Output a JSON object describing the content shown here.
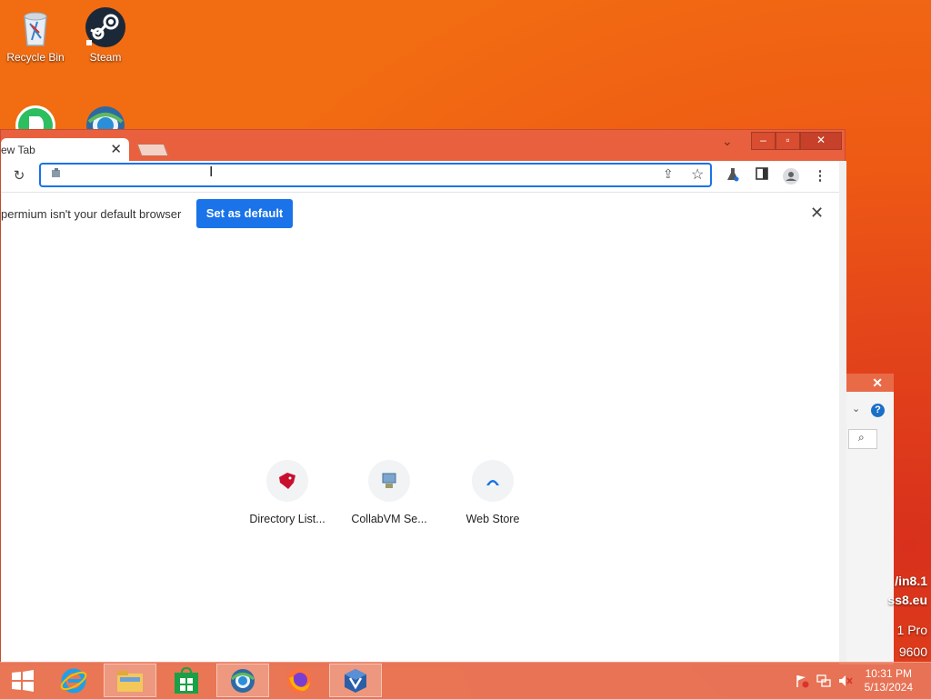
{
  "desktop": {
    "icons": [
      {
        "label": "Recycle Bin"
      },
      {
        "label": "Steam"
      }
    ],
    "right_edge_text": [
      "/in8.1",
      "ss8.eu",
      "1 Pro",
      "9600"
    ]
  },
  "browser": {
    "tab": {
      "title": "ew Tab",
      "close": "✕"
    },
    "omnibox": {
      "value": "",
      "placeholder": ""
    },
    "infobar": {
      "message": "permium isn't your default browser",
      "button": "Set as default",
      "close": "✕"
    },
    "shortcuts": [
      {
        "label": "Directory List..."
      },
      {
        "label": "CollabVM Se..."
      },
      {
        "label": "Web Store"
      }
    ]
  },
  "taskbar": {
    "time": "10:31 PM",
    "date": "5/13/2024"
  },
  "colors": {
    "accent": "#1a73e8",
    "window_frame": "#e9603e"
  }
}
